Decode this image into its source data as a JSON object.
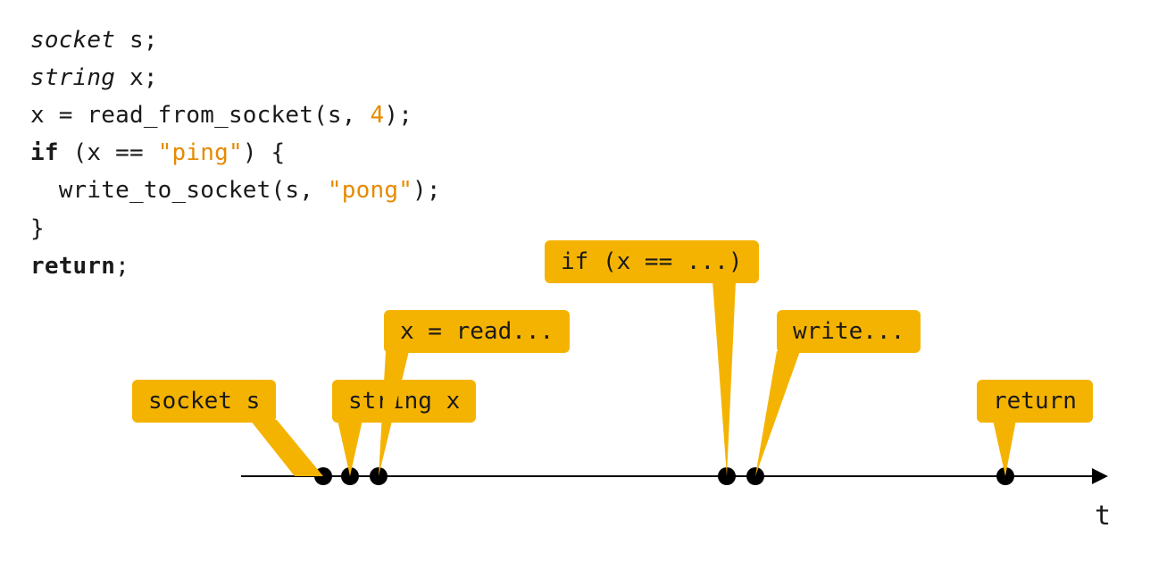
{
  "code": {
    "line1_type": "socket",
    "line1_var": " s;",
    "line2_type": "string",
    "line2_var": " x;",
    "line3_pre": "x = read_from_socket(s, ",
    "line3_lit": "4",
    "line3_post": ");",
    "line4_kw": "if",
    "line4_pre": " (x == ",
    "line4_lit": "\"ping\"",
    "line4_post": ") {",
    "line5_pre": "  write_to_socket(s, ",
    "line5_lit": "\"pong\"",
    "line5_post": ");",
    "line6": "}",
    "line7_kw": "return",
    "line7_post": ";"
  },
  "timeline": {
    "axis_label": "t",
    "events": {
      "socket_s": "socket s",
      "string_x": "string x",
      "x_read": "x = read...",
      "if_x": "if (x == ...)",
      "write": "write...",
      "return": "return"
    }
  }
}
